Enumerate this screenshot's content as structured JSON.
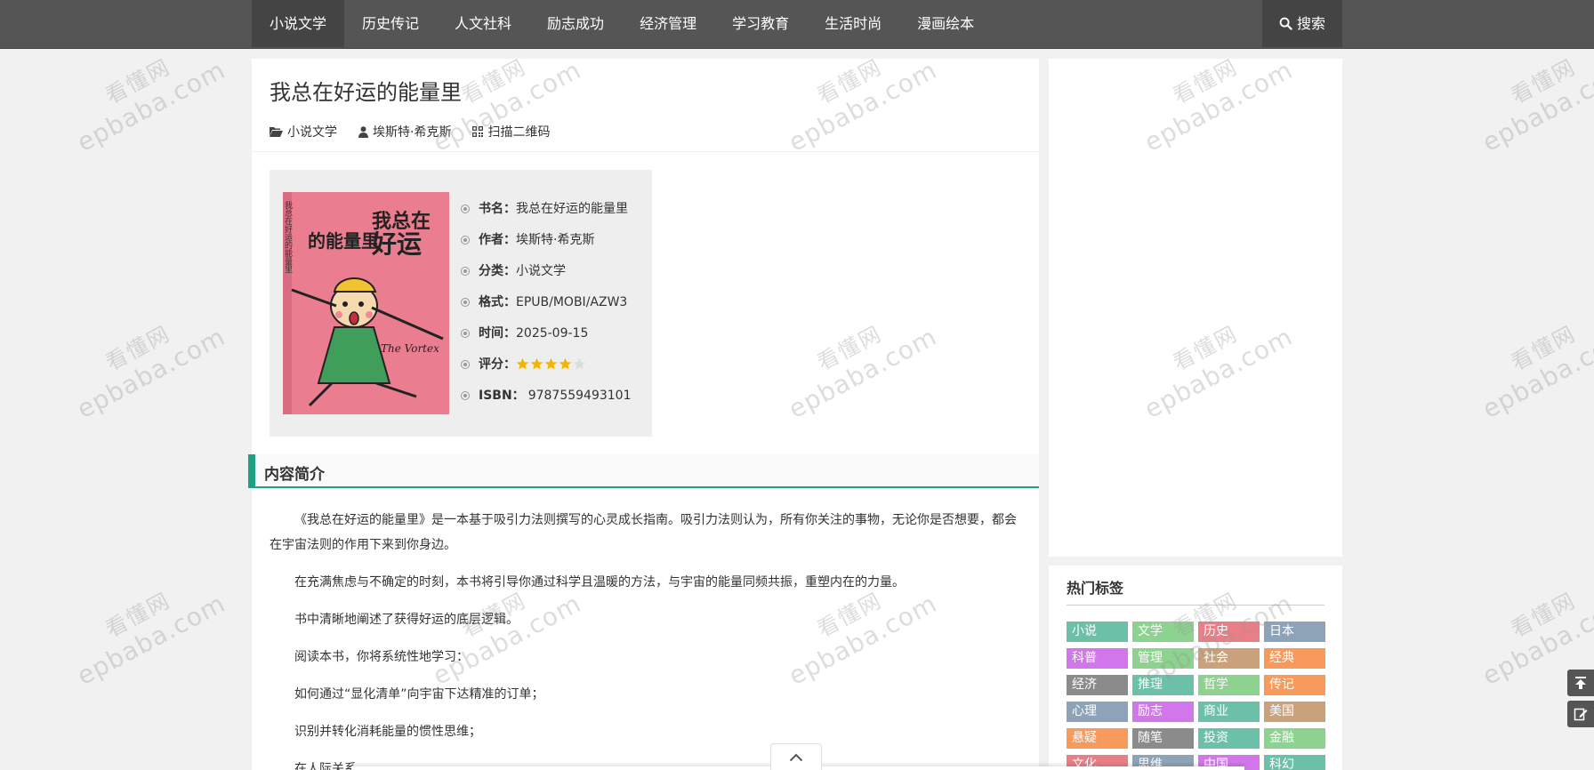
{
  "nav": {
    "items": [
      "小说文学",
      "历史传记",
      "人文社科",
      "励志成功",
      "经济管理",
      "学习教育",
      "生活时尚",
      "漫画绘本"
    ],
    "active_index": 0,
    "search_label": "搜索"
  },
  "post": {
    "title": "我总在好运的能量里",
    "meta": {
      "category": "小说文学",
      "author": "埃斯特·希克斯",
      "qrcode": "扫描二维码"
    }
  },
  "book": {
    "name_label": "书名：",
    "name": "我总在好运的能量里",
    "author_label": "作者：",
    "author": "埃斯特·希克斯",
    "category_label": "分类：",
    "category": "小说文学",
    "format_label": "格式：",
    "format": "EPUB/MOBI/AZW3",
    "date_label": "时间：",
    "date": "2025-09-15",
    "rating_label": "评分：",
    "rating": 4,
    "rating_max": 5,
    "isbn_label": "ISBN：",
    "isbn": "9787559493101",
    "cover": {
      "title_a": "我总在",
      "title_b": "好运",
      "title_c": "的能量里",
      "spine": "我总在好运的能量里",
      "caption": "The Vortex"
    }
  },
  "intro": {
    "heading": "内容简介",
    "paragraphs": [
      "《我总在好运的能量里》是一本基于吸引力法则撰写的心灵成长指南。吸引力法则认为，所有你关注的事物，无论你是否想要，都会在宇宙法则的作用下来到你身边。",
      "在充满焦虑与不确定的时刻，本书将引导你通过科学且温暖的方法，与宇宙的能量同频共振，重塑内在的力量。",
      "书中清晰地阐述了获得好运的底层逻辑。",
      "阅读本书，你将系统性地学习：",
      "如何通过“显化清单”向宇宙下达精准的订单；",
      "识别并转化消耗能量的惯性思维；",
      "在人际关系"
    ]
  },
  "sidebar": {
    "tags_title": "热门标签",
    "tags": [
      {
        "label": "小说",
        "color": "#6cc0a7"
      },
      {
        "label": "文学",
        "color": "#8dd28f"
      },
      {
        "label": "历史",
        "color": "#e97f86"
      },
      {
        "label": "日本",
        "color": "#8ea3b8"
      },
      {
        "label": "科普",
        "color": "#d276ec"
      },
      {
        "label": "管理",
        "color": "#8dd28f"
      },
      {
        "label": "社会",
        "color": "#c9a27c"
      },
      {
        "label": "经典",
        "color": "#f79a5c"
      },
      {
        "label": "经济",
        "color": "#8b8b8b"
      },
      {
        "label": "推理",
        "color": "#6cc0a7"
      },
      {
        "label": "哲学",
        "color": "#8dd28f"
      },
      {
        "label": "传记",
        "color": "#f79a5c"
      },
      {
        "label": "心理",
        "color": "#8ea3b8"
      },
      {
        "label": "励志",
        "color": "#d276ec"
      },
      {
        "label": "商业",
        "color": "#6cc0a7"
      },
      {
        "label": "美国",
        "color": "#c9a27c"
      },
      {
        "label": "悬疑",
        "color": "#f79a5c"
      },
      {
        "label": "随笔",
        "color": "#8b8b8b"
      },
      {
        "label": "投资",
        "color": "#6cc0a7"
      },
      {
        "label": "金融",
        "color": "#8dd28f"
      },
      {
        "label": "文化",
        "color": "#e97f86"
      },
      {
        "label": "思维",
        "color": "#8ea3b8"
      },
      {
        "label": "中国",
        "color": "#d276ec"
      },
      {
        "label": "科幻",
        "color": "#6cc0a7"
      }
    ]
  },
  "watermark": {
    "line1": "看懂网",
    "line2": "epbaba.com"
  }
}
